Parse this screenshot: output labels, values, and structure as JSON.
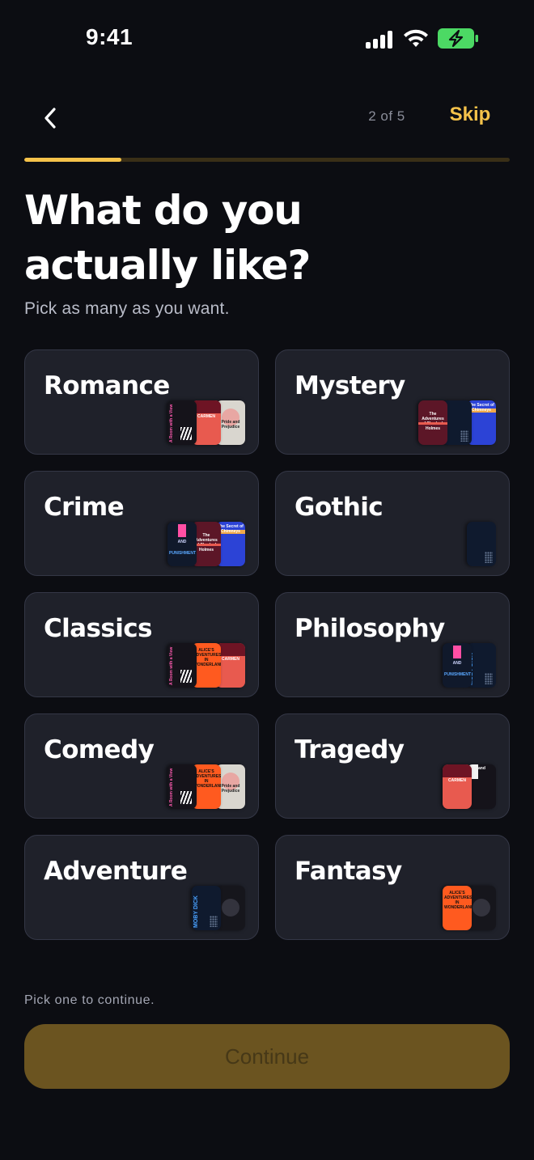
{
  "status_bar": {
    "time": "9:41",
    "battery_color": "#4cd964"
  },
  "nav": {
    "step": "2 of 5",
    "skip_label": "Skip",
    "progress_fraction": 0.2
  },
  "heading": {
    "line1": "What do you",
    "line2": "actually like?",
    "subtitle": "Pick as many as you want."
  },
  "genres": [
    {
      "label": "Romance",
      "covers": [
        "red-white",
        "carmen",
        "pride-and-prejudice"
      ]
    },
    {
      "label": "Mystery",
      "covers": [
        "sherlock",
        "dark-navy",
        "secret-of-chimneys"
      ]
    },
    {
      "label": "Crime",
      "covers": [
        "crime-and-punishment",
        "sherlock",
        "secret-of-chimneys"
      ]
    },
    {
      "label": "Gothic",
      "covers": [
        "dark-navy"
      ]
    },
    {
      "label": "Classics",
      "covers": [
        "red-white",
        "alice-in-wonderland",
        "carmen"
      ]
    },
    {
      "label": "Philosophy",
      "covers": [
        "crime-and-punishment",
        "moby-dick"
      ]
    },
    {
      "label": "Comedy",
      "covers": [
        "red-white",
        "alice-in-wonderland",
        "pride-and-prejudice"
      ]
    },
    {
      "label": "Tragedy",
      "covers": [
        "carmen",
        "black-white"
      ]
    },
    {
      "label": "Adventure",
      "covers": [
        "moby-dick",
        "dark-circle"
      ]
    },
    {
      "label": "Fantasy",
      "covers": [
        "alice-in-wonderland",
        "dark-circle"
      ]
    }
  ],
  "cover_text": {
    "carmen": "CARMEN",
    "pride": "Pride and Prejudice",
    "sherlock": "The Adventures of Sherlock Holmes",
    "chimneys": "The Secret of Chimneys",
    "alice": "ALICE'S ADVENTURES IN WONDERLAND",
    "moby": "MOBY DICK",
    "crime_and": "AND",
    "punishment": "PUNISHMENT",
    "red_white": "A Room with a View",
    "black_white": "and"
  },
  "footer": {
    "hint": "Pick one to continue.",
    "continue_label": "Continue"
  }
}
